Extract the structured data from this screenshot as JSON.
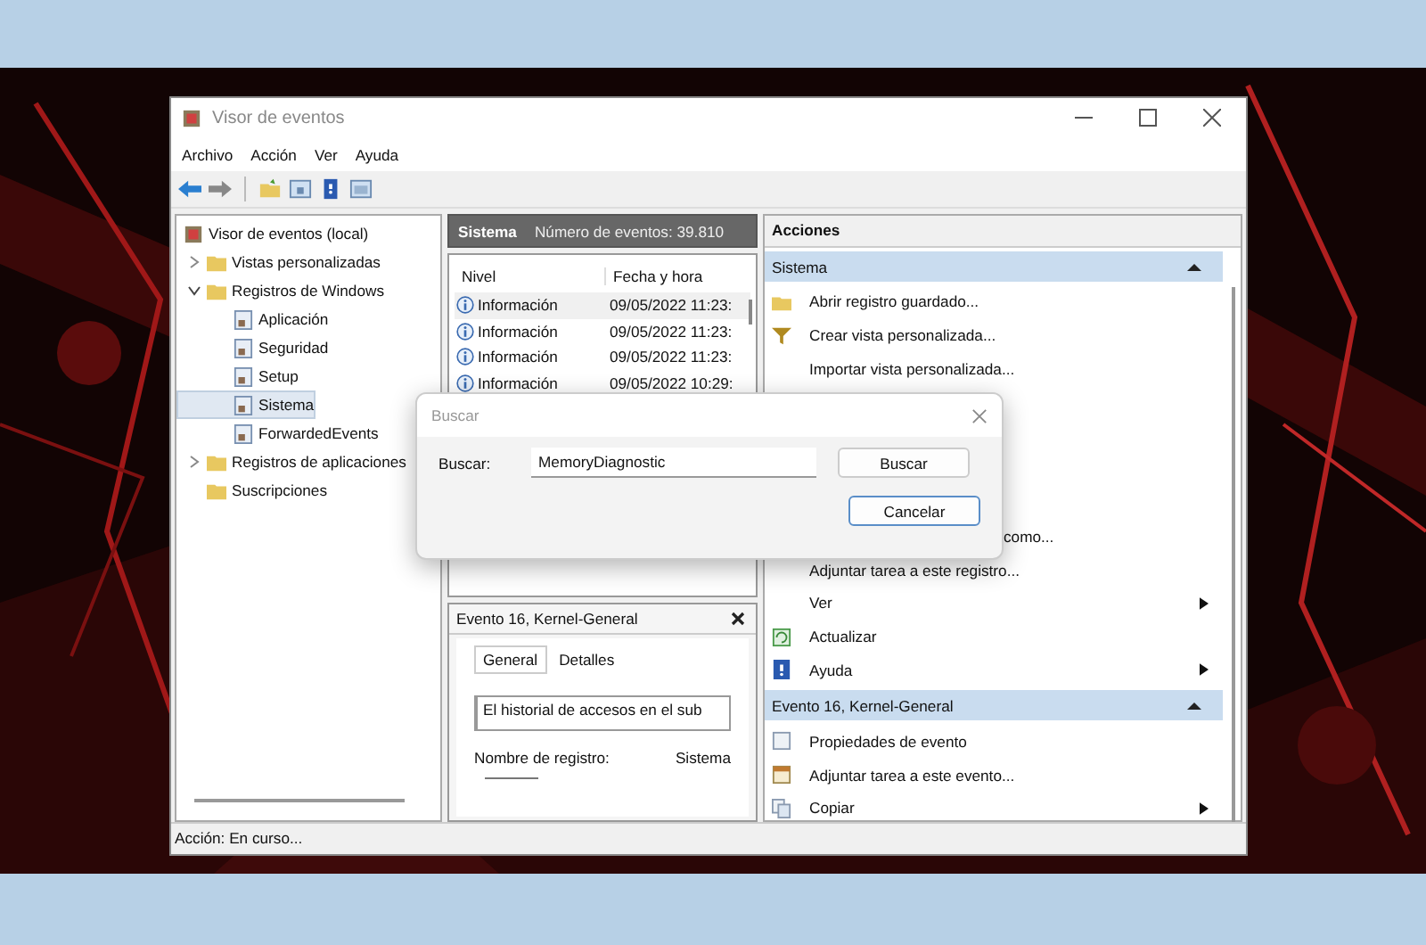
{
  "window": {
    "title": "Visor de eventos"
  },
  "menu": [
    "Archivo",
    "Acción",
    "Ver",
    "Ayuda"
  ],
  "tree": [
    {
      "label": "Visor de eventos (local)",
      "selected": false,
      "children": [
        {
          "label": "Vistas personalizadas",
          "expanded": false,
          "selected": false
        },
        {
          "label": "Registros de Windows",
          "expanded": true,
          "selected": false,
          "children": [
            {
              "label": "Aplicación",
              "selected": false
            },
            {
              "label": "Seguridad",
              "selected": false
            },
            {
              "label": "Setup",
              "selected": false
            },
            {
              "label": "Sistema",
              "selected": true
            },
            {
              "label": "ForwardedEvents",
              "selected": false
            }
          ]
        },
        {
          "label": "Registros de aplicaciones",
          "expanded": false,
          "selected": false
        },
        {
          "label": "Suscripciones",
          "selected": false
        }
      ]
    }
  ],
  "log_header": {
    "name": "Sistema",
    "count": "Número de eventos: 39.810"
  },
  "table": {
    "columns": [
      "Nivel",
      "Fecha y hora"
    ],
    "rows": [
      {
        "level": "Información",
        "date": "09/05/2022 11:23:",
        "selected": true
      },
      {
        "level": "Información",
        "date": "09/05/2022 11:23:",
        "selected": false
      },
      {
        "level": "Información",
        "date": "09/05/2022 11:23:",
        "selected": false
      },
      {
        "level": "Información",
        "date": "09/05/2022 10:29:",
        "selected": false
      }
    ]
  },
  "event_panel": {
    "title": "Evento 16, Kernel-General",
    "tabs": [
      {
        "label": "General",
        "selected": true
      },
      {
        "label": "Detalles",
        "selected": false
      }
    ],
    "description": "El historial de accesos en el sub",
    "field_label": "Nombre de registro:",
    "field_value": "Sistema"
  },
  "actions": {
    "title": "Acciones",
    "sections": [
      {
        "title": "Sistema",
        "items": [
          {
            "label": "Abrir registro guardado...",
            "kind": "open",
            "submenu": false
          },
          {
            "label": "Crear vista personalizada...",
            "kind": "filter",
            "submenu": false
          },
          {
            "label": "Importar vista personalizada...",
            "kind": "plain",
            "submenu": false
          },
          {
            "label": "como...",
            "kind": "partial",
            "submenu": false
          },
          {
            "label": "Adjuntar tarea a este registro...",
            "kind": "plain",
            "submenu": false
          },
          {
            "label": "Ver",
            "kind": "plain",
            "submenu": true
          },
          {
            "label": "Actualizar",
            "kind": "refresh",
            "submenu": false
          },
          {
            "label": "Ayuda",
            "kind": "help",
            "submenu": true
          }
        ]
      },
      {
        "title": "Evento 16, Kernel-General",
        "items": [
          {
            "label": "Propiedades de evento",
            "kind": "properties",
            "submenu": false
          },
          {
            "label": "Adjuntar tarea a este evento...",
            "kind": "task",
            "submenu": false
          },
          {
            "label": "Copiar",
            "kind": "copy",
            "submenu": true
          }
        ]
      }
    ]
  },
  "status_bar": "Acción: En curso...",
  "dialog": {
    "title": "Buscar",
    "label": "Buscar:",
    "value": "MemoryDiagnostic",
    "buttons": [
      {
        "label": "Buscar",
        "focused": false
      },
      {
        "label": "Cancelar",
        "focused": true
      }
    ]
  }
}
